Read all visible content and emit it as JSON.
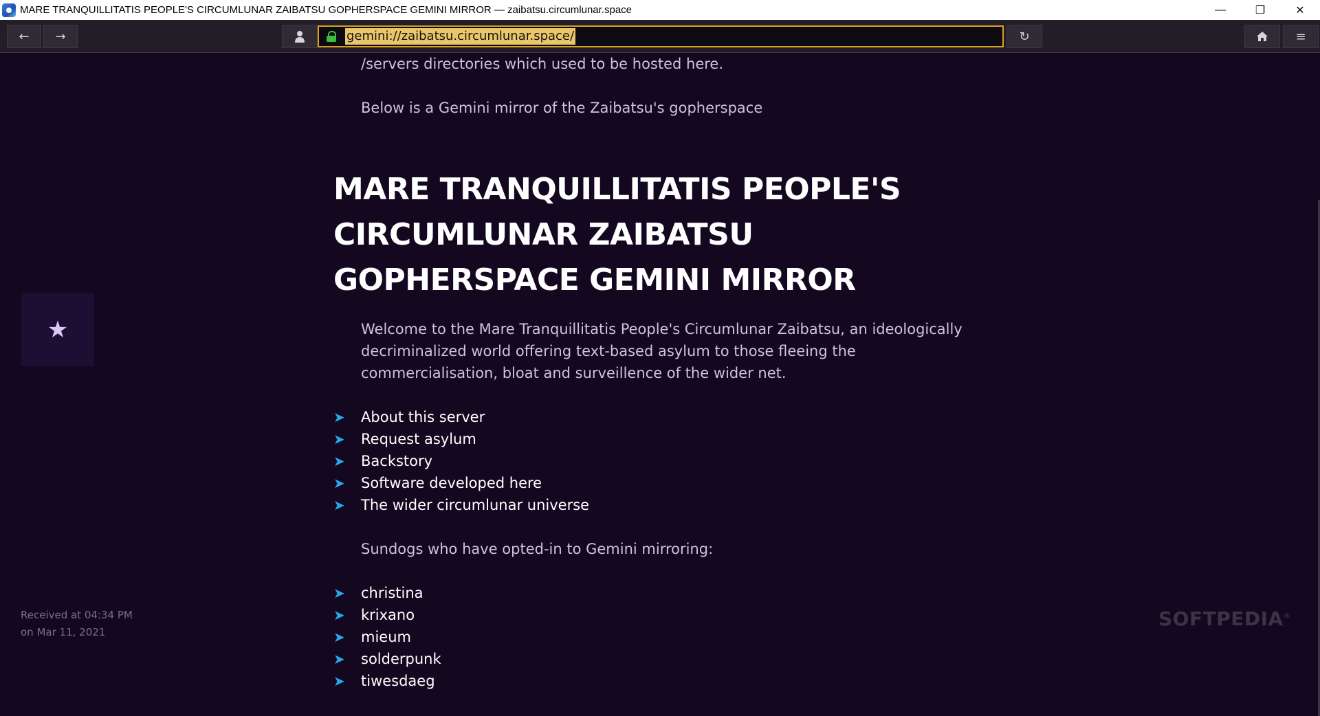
{
  "window": {
    "title": "MARE TRANQUILLITATIS PEOPLE'S CIRCUMLUNAR ZAIBATSU GOPHERSPACE GEMINI MIRROR — zaibatsu.circumlunar.space",
    "minimize_icon": "minimize-icon",
    "maximize_icon": "restore-icon",
    "close_icon": "close-icon"
  },
  "toolbar": {
    "back_icon": "arrow-left-icon",
    "forward_icon": "arrow-right-icon",
    "identity_icon": "person-icon",
    "url": "gemini://zaibatsu.circumlunar.space/",
    "reload_icon": "reload-icon",
    "home_icon": "home-icon",
    "menu_icon": "hamburger-menu-icon"
  },
  "page": {
    "intro_tail": "/servers directories which used to be hosted here.",
    "mirror_note": "Below is a Gemini mirror of the Zaibatsu's gopherspace",
    "heading": "MARE TRANQUILLITATIS PEOPLE'S CIRCUMLUNAR ZAIBATSU GOPHERSPACE GEMINI MIRROR",
    "welcome": "Welcome to the Mare Tranquillitatis People's Circumlunar Zaibatsu, an ideologically decriminalized world offering text-based asylum to those fleeing the commercialisation, bloat and surveillence of the wider net.",
    "links": [
      "About this server",
      "Request asylum",
      "Backstory",
      "Software developed here",
      "The wider circumlunar universe"
    ],
    "sundogs_intro": "Sundogs who have opted-in to Gemini mirroring:",
    "sundogs": [
      "christina",
      "krixano",
      "mieum",
      "solderpunk",
      "tiwesdaeg"
    ]
  },
  "sidebar": {
    "bookmark_icon": "star-icon",
    "received_line1": "Received at 04:34 PM",
    "received_line2": "on Mar 11, 2021"
  },
  "watermark": "SOFTPEDIA",
  "colors": {
    "background": "#13081f",
    "link_arrow": "#27a9e8",
    "url_border": "#d9a21a",
    "url_highlight": "#e9c66a",
    "lock": "#3bbf3b"
  }
}
